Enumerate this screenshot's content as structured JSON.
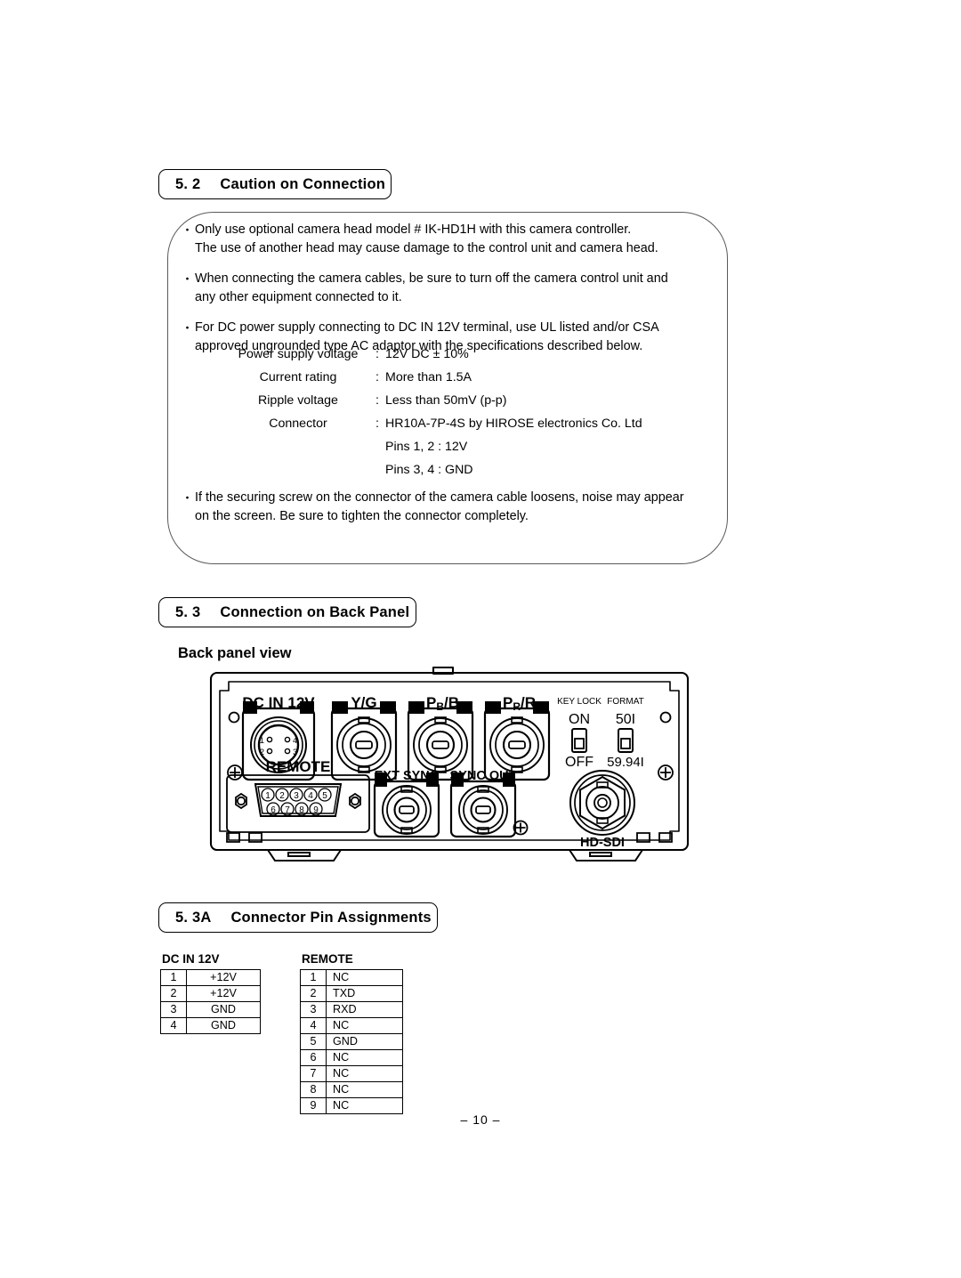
{
  "page": {
    "number_label": "– 10 –"
  },
  "sections": {
    "caution": {
      "number": "5. 2",
      "title": "Caution on Connection"
    },
    "connection_back_panel": {
      "number": "5. 3",
      "title": "Connection on Back Panel"
    },
    "pin_assignments": {
      "number": "5. 3A",
      "title": "Connector Pin Assignments"
    }
  },
  "caution": {
    "bullet_marker": "・",
    "items": [
      [
        "Only use optional camera head model # IK-HD1H with this camera controller.",
        "The use of another head may cause damage to the control unit and camera head."
      ],
      [
        "When connecting the camera cables, be sure to turn off the camera control unit and",
        "any other equipment connected to it."
      ],
      [
        "For DC power supply connecting to DC IN 12V terminal, use UL listed and/or CSA",
        "approved ungrounded type AC adaptor with the specifications described below."
      ],
      [
        "If the securing screw on the connector of the camera cable loosens, noise may appear",
        "on the screen. Be sure to tighten the connector completely."
      ]
    ]
  },
  "specs": {
    "colon": ":",
    "rows": [
      {
        "label": "Power supply voltage",
        "value": "12V DC ± 10%"
      },
      {
        "label": "Current rating",
        "value": "More than 1.5A"
      },
      {
        "label": "Ripple voltage",
        "value": "Less than 50mV (p-p)"
      },
      {
        "label": "Connector",
        "value": "HR10A-7P-4S by HIROSE electronics Co. Ltd"
      }
    ],
    "sub_rows": [
      "Pins 1, 2  :  12V",
      "Pins 3, 4  :  GND"
    ]
  },
  "back_panel": {
    "view_label": "Back panel view",
    "connectors": {
      "dc_in": "DC IN 12V",
      "yg": "Y/G",
      "pb_b_main": "P",
      "pb_b_sub": "B",
      "pb_b_tail": "/B",
      "pr_r_main": "P",
      "pr_r_sub": "R",
      "pr_r_tail": "/R",
      "remote": "REMOTE",
      "ext_sync": "EXT SYNC",
      "sync_out": "SYNC OUT",
      "hd_sdi": "HD-SDI"
    },
    "switches": {
      "key_lock_label": "KEY LOCK",
      "key_lock_top": "ON",
      "key_lock_bottom": "OFF",
      "format_label": "FORMAT",
      "format_top": "50I",
      "format_bottom": "59.94I"
    },
    "dc_in_pin_marks": [
      "1",
      "4",
      "2",
      "3"
    ],
    "remote_pin_marks": [
      "1",
      "2",
      "3",
      "4",
      "5",
      "6",
      "7",
      "8",
      "9"
    ]
  },
  "pin_tables": {
    "dc_in": {
      "title": "DC IN 12V",
      "rows": [
        {
          "pin": "1",
          "signal": "+12V"
        },
        {
          "pin": "2",
          "signal": "+12V"
        },
        {
          "pin": "3",
          "signal": "GND"
        },
        {
          "pin": "4",
          "signal": "GND"
        }
      ]
    },
    "remote": {
      "title": "REMOTE",
      "rows": [
        {
          "pin": "1",
          "signal": "NC"
        },
        {
          "pin": "2",
          "signal": "TXD"
        },
        {
          "pin": "3",
          "signal": "RXD"
        },
        {
          "pin": "4",
          "signal": "NC"
        },
        {
          "pin": "5",
          "signal": "GND"
        },
        {
          "pin": "6",
          "signal": "NC"
        },
        {
          "pin": "7",
          "signal": "NC"
        },
        {
          "pin": "8",
          "signal": "NC"
        },
        {
          "pin": "9",
          "signal": "NC"
        }
      ]
    }
  },
  "colors": {
    "ink": "#000000",
    "box_stroke": "#5a5a5a",
    "paper": "#ffffff"
  }
}
